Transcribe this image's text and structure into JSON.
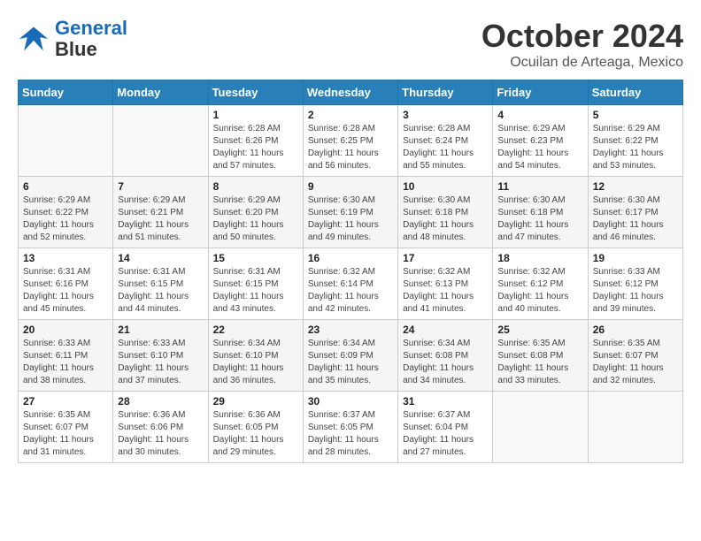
{
  "header": {
    "logo_line1": "General",
    "logo_line2": "Blue",
    "month": "October 2024",
    "location": "Ocuilan de Arteaga, Mexico"
  },
  "days_of_week": [
    "Sunday",
    "Monday",
    "Tuesday",
    "Wednesday",
    "Thursday",
    "Friday",
    "Saturday"
  ],
  "weeks": [
    [
      {
        "day": "",
        "sunrise": "",
        "sunset": "",
        "daylight": ""
      },
      {
        "day": "",
        "sunrise": "",
        "sunset": "",
        "daylight": ""
      },
      {
        "day": "1",
        "sunrise": "Sunrise: 6:28 AM",
        "sunset": "Sunset: 6:26 PM",
        "daylight": "Daylight: 11 hours and 57 minutes."
      },
      {
        "day": "2",
        "sunrise": "Sunrise: 6:28 AM",
        "sunset": "Sunset: 6:25 PM",
        "daylight": "Daylight: 11 hours and 56 minutes."
      },
      {
        "day": "3",
        "sunrise": "Sunrise: 6:28 AM",
        "sunset": "Sunset: 6:24 PM",
        "daylight": "Daylight: 11 hours and 55 minutes."
      },
      {
        "day": "4",
        "sunrise": "Sunrise: 6:29 AM",
        "sunset": "Sunset: 6:23 PM",
        "daylight": "Daylight: 11 hours and 54 minutes."
      },
      {
        "day": "5",
        "sunrise": "Sunrise: 6:29 AM",
        "sunset": "Sunset: 6:22 PM",
        "daylight": "Daylight: 11 hours and 53 minutes."
      }
    ],
    [
      {
        "day": "6",
        "sunrise": "Sunrise: 6:29 AM",
        "sunset": "Sunset: 6:22 PM",
        "daylight": "Daylight: 11 hours and 52 minutes."
      },
      {
        "day": "7",
        "sunrise": "Sunrise: 6:29 AM",
        "sunset": "Sunset: 6:21 PM",
        "daylight": "Daylight: 11 hours and 51 minutes."
      },
      {
        "day": "8",
        "sunrise": "Sunrise: 6:29 AM",
        "sunset": "Sunset: 6:20 PM",
        "daylight": "Daylight: 11 hours and 50 minutes."
      },
      {
        "day": "9",
        "sunrise": "Sunrise: 6:30 AM",
        "sunset": "Sunset: 6:19 PM",
        "daylight": "Daylight: 11 hours and 49 minutes."
      },
      {
        "day": "10",
        "sunrise": "Sunrise: 6:30 AM",
        "sunset": "Sunset: 6:18 PM",
        "daylight": "Daylight: 11 hours and 48 minutes."
      },
      {
        "day": "11",
        "sunrise": "Sunrise: 6:30 AM",
        "sunset": "Sunset: 6:18 PM",
        "daylight": "Daylight: 11 hours and 47 minutes."
      },
      {
        "day": "12",
        "sunrise": "Sunrise: 6:30 AM",
        "sunset": "Sunset: 6:17 PM",
        "daylight": "Daylight: 11 hours and 46 minutes."
      }
    ],
    [
      {
        "day": "13",
        "sunrise": "Sunrise: 6:31 AM",
        "sunset": "Sunset: 6:16 PM",
        "daylight": "Daylight: 11 hours and 45 minutes."
      },
      {
        "day": "14",
        "sunrise": "Sunrise: 6:31 AM",
        "sunset": "Sunset: 6:15 PM",
        "daylight": "Daylight: 11 hours and 44 minutes."
      },
      {
        "day": "15",
        "sunrise": "Sunrise: 6:31 AM",
        "sunset": "Sunset: 6:15 PM",
        "daylight": "Daylight: 11 hours and 43 minutes."
      },
      {
        "day": "16",
        "sunrise": "Sunrise: 6:32 AM",
        "sunset": "Sunset: 6:14 PM",
        "daylight": "Daylight: 11 hours and 42 minutes."
      },
      {
        "day": "17",
        "sunrise": "Sunrise: 6:32 AM",
        "sunset": "Sunset: 6:13 PM",
        "daylight": "Daylight: 11 hours and 41 minutes."
      },
      {
        "day": "18",
        "sunrise": "Sunrise: 6:32 AM",
        "sunset": "Sunset: 6:12 PM",
        "daylight": "Daylight: 11 hours and 40 minutes."
      },
      {
        "day": "19",
        "sunrise": "Sunrise: 6:33 AM",
        "sunset": "Sunset: 6:12 PM",
        "daylight": "Daylight: 11 hours and 39 minutes."
      }
    ],
    [
      {
        "day": "20",
        "sunrise": "Sunrise: 6:33 AM",
        "sunset": "Sunset: 6:11 PM",
        "daylight": "Daylight: 11 hours and 38 minutes."
      },
      {
        "day": "21",
        "sunrise": "Sunrise: 6:33 AM",
        "sunset": "Sunset: 6:10 PM",
        "daylight": "Daylight: 11 hours and 37 minutes."
      },
      {
        "day": "22",
        "sunrise": "Sunrise: 6:34 AM",
        "sunset": "Sunset: 6:10 PM",
        "daylight": "Daylight: 11 hours and 36 minutes."
      },
      {
        "day": "23",
        "sunrise": "Sunrise: 6:34 AM",
        "sunset": "Sunset: 6:09 PM",
        "daylight": "Daylight: 11 hours and 35 minutes."
      },
      {
        "day": "24",
        "sunrise": "Sunrise: 6:34 AM",
        "sunset": "Sunset: 6:08 PM",
        "daylight": "Daylight: 11 hours and 34 minutes."
      },
      {
        "day": "25",
        "sunrise": "Sunrise: 6:35 AM",
        "sunset": "Sunset: 6:08 PM",
        "daylight": "Daylight: 11 hours and 33 minutes."
      },
      {
        "day": "26",
        "sunrise": "Sunrise: 6:35 AM",
        "sunset": "Sunset: 6:07 PM",
        "daylight": "Daylight: 11 hours and 32 minutes."
      }
    ],
    [
      {
        "day": "27",
        "sunrise": "Sunrise: 6:35 AM",
        "sunset": "Sunset: 6:07 PM",
        "daylight": "Daylight: 11 hours and 31 minutes."
      },
      {
        "day": "28",
        "sunrise": "Sunrise: 6:36 AM",
        "sunset": "Sunset: 6:06 PM",
        "daylight": "Daylight: 11 hours and 30 minutes."
      },
      {
        "day": "29",
        "sunrise": "Sunrise: 6:36 AM",
        "sunset": "Sunset: 6:05 PM",
        "daylight": "Daylight: 11 hours and 29 minutes."
      },
      {
        "day": "30",
        "sunrise": "Sunrise: 6:37 AM",
        "sunset": "Sunset: 6:05 PM",
        "daylight": "Daylight: 11 hours and 28 minutes."
      },
      {
        "day": "31",
        "sunrise": "Sunrise: 6:37 AM",
        "sunset": "Sunset: 6:04 PM",
        "daylight": "Daylight: 11 hours and 27 minutes."
      },
      {
        "day": "",
        "sunrise": "",
        "sunset": "",
        "daylight": ""
      },
      {
        "day": "",
        "sunrise": "",
        "sunset": "",
        "daylight": ""
      }
    ]
  ]
}
